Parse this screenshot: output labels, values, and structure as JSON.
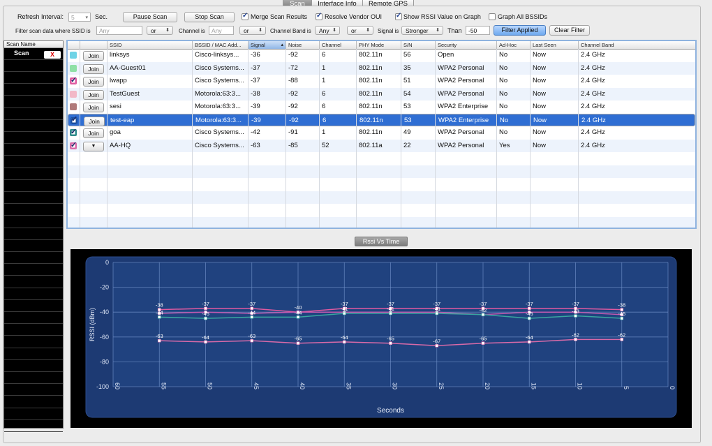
{
  "tabs": [
    {
      "label": "Scan",
      "active": true
    },
    {
      "label": "Interface Info",
      "active": false
    },
    {
      "label": "Remote GPS",
      "active": false
    }
  ],
  "controls": {
    "refresh_label": "Refresh Interval:",
    "refresh_value": "5",
    "sec_label": "Sec.",
    "pause_button": "Pause Scan",
    "stop_button": "Stop Scan",
    "merge_label": "Merge Scan Results",
    "merge_checked": true,
    "resolve_label": "Resolve Vendor OUI",
    "resolve_checked": true,
    "show_rssi_label": "Show RSSI Value on Graph",
    "show_rssi_checked": true,
    "graph_all_label": "Graph All BSSIDs",
    "graph_all_checked": false
  },
  "filter": {
    "ssid_label": "Filter scan data where SSID is",
    "ssid_placeholder": "Any",
    "op1": "or",
    "channel_label": "Channel is",
    "channel_placeholder": "Any",
    "op2": "or",
    "band_label": "Channel Band is",
    "band_value": "Any",
    "op3": "or",
    "signal_label": "Signal is",
    "signal_value": "Stronger",
    "than_label": "Than",
    "than_value": "-50",
    "applied_button": "Filter Applied",
    "clear_button": "Clear Filter"
  },
  "scan_list": {
    "header": "Scan Name",
    "items": [
      {
        "name": "Scan",
        "close": "X"
      }
    ]
  },
  "table": {
    "columns": [
      "",
      "",
      "SSID",
      "BSSID / MAC Add...",
      "Signal",
      "Noise",
      "Channel",
      "PHY Mode",
      "S/N",
      "Security",
      "Ad-Hoc",
      "Last Seen",
      "Channel Band"
    ],
    "join_label": "Join",
    "rows": [
      {
        "color": "#6fd3e6",
        "checked": false,
        "selected": false,
        "action": "Join",
        "ssid": "linksys",
        "bssid": "Cisco-linksys...",
        "signal": "-36",
        "noise": "-92",
        "channel": "6",
        "phy": "802.11n",
        "sn": "56",
        "security": "Open",
        "adhoc": "No",
        "last_seen": "Now",
        "band": "2.4 GHz"
      },
      {
        "color": "#8fe0a6",
        "checked": false,
        "selected": false,
        "action": "Join",
        "ssid": "AA-Guest01",
        "bssid": "Cisco Systems...",
        "signal": "-37",
        "noise": "-72",
        "channel": "1",
        "phy": "802.11n",
        "sn": "35",
        "security": "WPA2 Personal",
        "adhoc": "No",
        "last_seen": "Now",
        "band": "2.4 GHz"
      },
      {
        "color": "#e05aa0",
        "checked": true,
        "selected": false,
        "action": "Join",
        "ssid": "lwapp",
        "bssid": "Cisco Systems...",
        "signal": "-37",
        "noise": "-88",
        "channel": "1",
        "phy": "802.11n",
        "sn": "51",
        "security": "WPA2 Personal",
        "adhoc": "No",
        "last_seen": "Now",
        "band": "2.4 GHz"
      },
      {
        "color": "#f2b8c8",
        "checked": false,
        "selected": false,
        "action": "Join",
        "ssid": "TestGuest",
        "bssid": "Motorola:63:3...",
        "signal": "-38",
        "noise": "-92",
        "channel": "6",
        "phy": "802.11n",
        "sn": "54",
        "security": "WPA2 Personal",
        "adhoc": "No",
        "last_seen": "Now",
        "band": "2.4 GHz"
      },
      {
        "color": "#b07a7a",
        "checked": false,
        "selected": false,
        "action": "Join",
        "ssid": "sesi",
        "bssid": "Motorola:63:3...",
        "signal": "-39",
        "noise": "-92",
        "channel": "6",
        "phy": "802.11n",
        "sn": "53",
        "security": "WPA2 Enterprise",
        "adhoc": "No",
        "last_seen": "Now",
        "band": "2.4 GHz"
      },
      {
        "color": "#1a4fa0",
        "checked": true,
        "selected": true,
        "action": "Join",
        "ssid": "test-eap",
        "bssid": "Motorola:63:3...",
        "signal": "-39",
        "noise": "-92",
        "channel": "6",
        "phy": "802.11n",
        "sn": "53",
        "security": "WPA2 Enterprise",
        "adhoc": "No",
        "last_seen": "Now",
        "band": "2.4 GHz"
      },
      {
        "color": "#2e8a8a",
        "checked": true,
        "selected": false,
        "action": "Join",
        "ssid": "goa",
        "bssid": "Cisco Systems...",
        "signal": "-42",
        "noise": "-91",
        "channel": "1",
        "phy": "802.11n",
        "sn": "49",
        "security": "WPA2 Personal",
        "adhoc": "No",
        "last_seen": "Now",
        "band": "2.4 GHz"
      },
      {
        "color": "#d96aa8",
        "checked": true,
        "selected": false,
        "action": "dropdown",
        "ssid": "AA-HQ",
        "bssid": "Cisco Systems...",
        "signal": "-63",
        "noise": "-85",
        "channel": "52",
        "phy": "802.11a",
        "sn": "22",
        "security": "WPA2 Personal",
        "adhoc": "Yes",
        "last_seen": "Now",
        "band": "2.4 GHz"
      }
    ]
  },
  "graph_tab": "Rssi Vs Time",
  "chart_data": {
    "type": "line",
    "title": "",
    "xlabel": "Seconds",
    "ylabel": "RSSI (dBm)",
    "xlim": [
      60,
      0
    ],
    "ylim": [
      -100,
      0
    ],
    "x_ticks": [
      60,
      55,
      50,
      45,
      40,
      35,
      30,
      25,
      20,
      15,
      10,
      5,
      0
    ],
    "y_ticks": [
      0,
      -20,
      -40,
      -60,
      -80,
      -100
    ],
    "grid": true,
    "x": [
      55,
      50,
      45,
      40,
      35,
      30,
      25,
      20,
      15,
      10,
      5
    ],
    "series": [
      {
        "color": "#e05aa0",
        "values": [
          -38,
          -37,
          -37,
          -40,
          -37,
          -37,
          -37,
          -37,
          -37,
          -37,
          -38
        ],
        "show_labels": true
      },
      {
        "color": "#c05ab0",
        "values": [
          -41,
          -40,
          -41,
          -40,
          -40,
          -40,
          -40,
          -42,
          -40,
          -40,
          -42
        ],
        "show_labels": false
      },
      {
        "color": "#3aa6a0",
        "values": [
          -44,
          -45,
          -44,
          -44,
          -41,
          -41,
          -41,
          -42,
          -45,
          -43,
          -45
        ],
        "show_labels": true
      },
      {
        "color": "#d96aa8",
        "values": [
          -63,
          -64,
          -63,
          -65,
          -64,
          -65,
          -67,
          -65,
          -64,
          -62,
          -62
        ],
        "show_labels": true
      }
    ]
  }
}
